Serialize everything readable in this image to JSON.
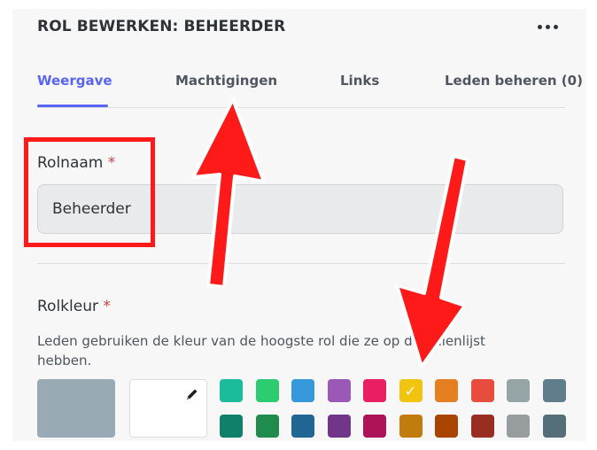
{
  "header": {
    "title": "ROL BEWERKEN: BEHEERDER",
    "more_icon": "more-horizontal-icon"
  },
  "tabs": [
    {
      "label": "Weergave",
      "active": true
    },
    {
      "label": "Machtigingen",
      "active": false
    },
    {
      "label": "Links",
      "active": false
    },
    {
      "label": "Leden beheren (0)",
      "active": false
    }
  ],
  "role_name": {
    "label": "Rolnaam",
    "required_mark": "*",
    "value": "Beheerder"
  },
  "role_color": {
    "label": "Rolkleur",
    "required_mark": "*",
    "description": "Leden gebruiken de kleur van de hoogste rol die ze op de rollenlijst hebben.",
    "default_color": "#99aab5",
    "custom_picker_icon": "pencil-icon",
    "selected": "#f1c40f",
    "row1": [
      "#1abc9c",
      "#2ecc71",
      "#3498db",
      "#9b59b6",
      "#e91e63",
      "#f1c40f",
      "#e67e22",
      "#e74c3c",
      "#95a5a6",
      "#607d8b"
    ],
    "row2": [
      "#11806a",
      "#1f8b4c",
      "#206694",
      "#71368a",
      "#ad1457",
      "#c27c0e",
      "#a84300",
      "#992d22",
      "#979c9f",
      "#546e7a"
    ]
  },
  "colors": {
    "accent": "#5865f2",
    "annotation_red": "#ff1a1a"
  }
}
